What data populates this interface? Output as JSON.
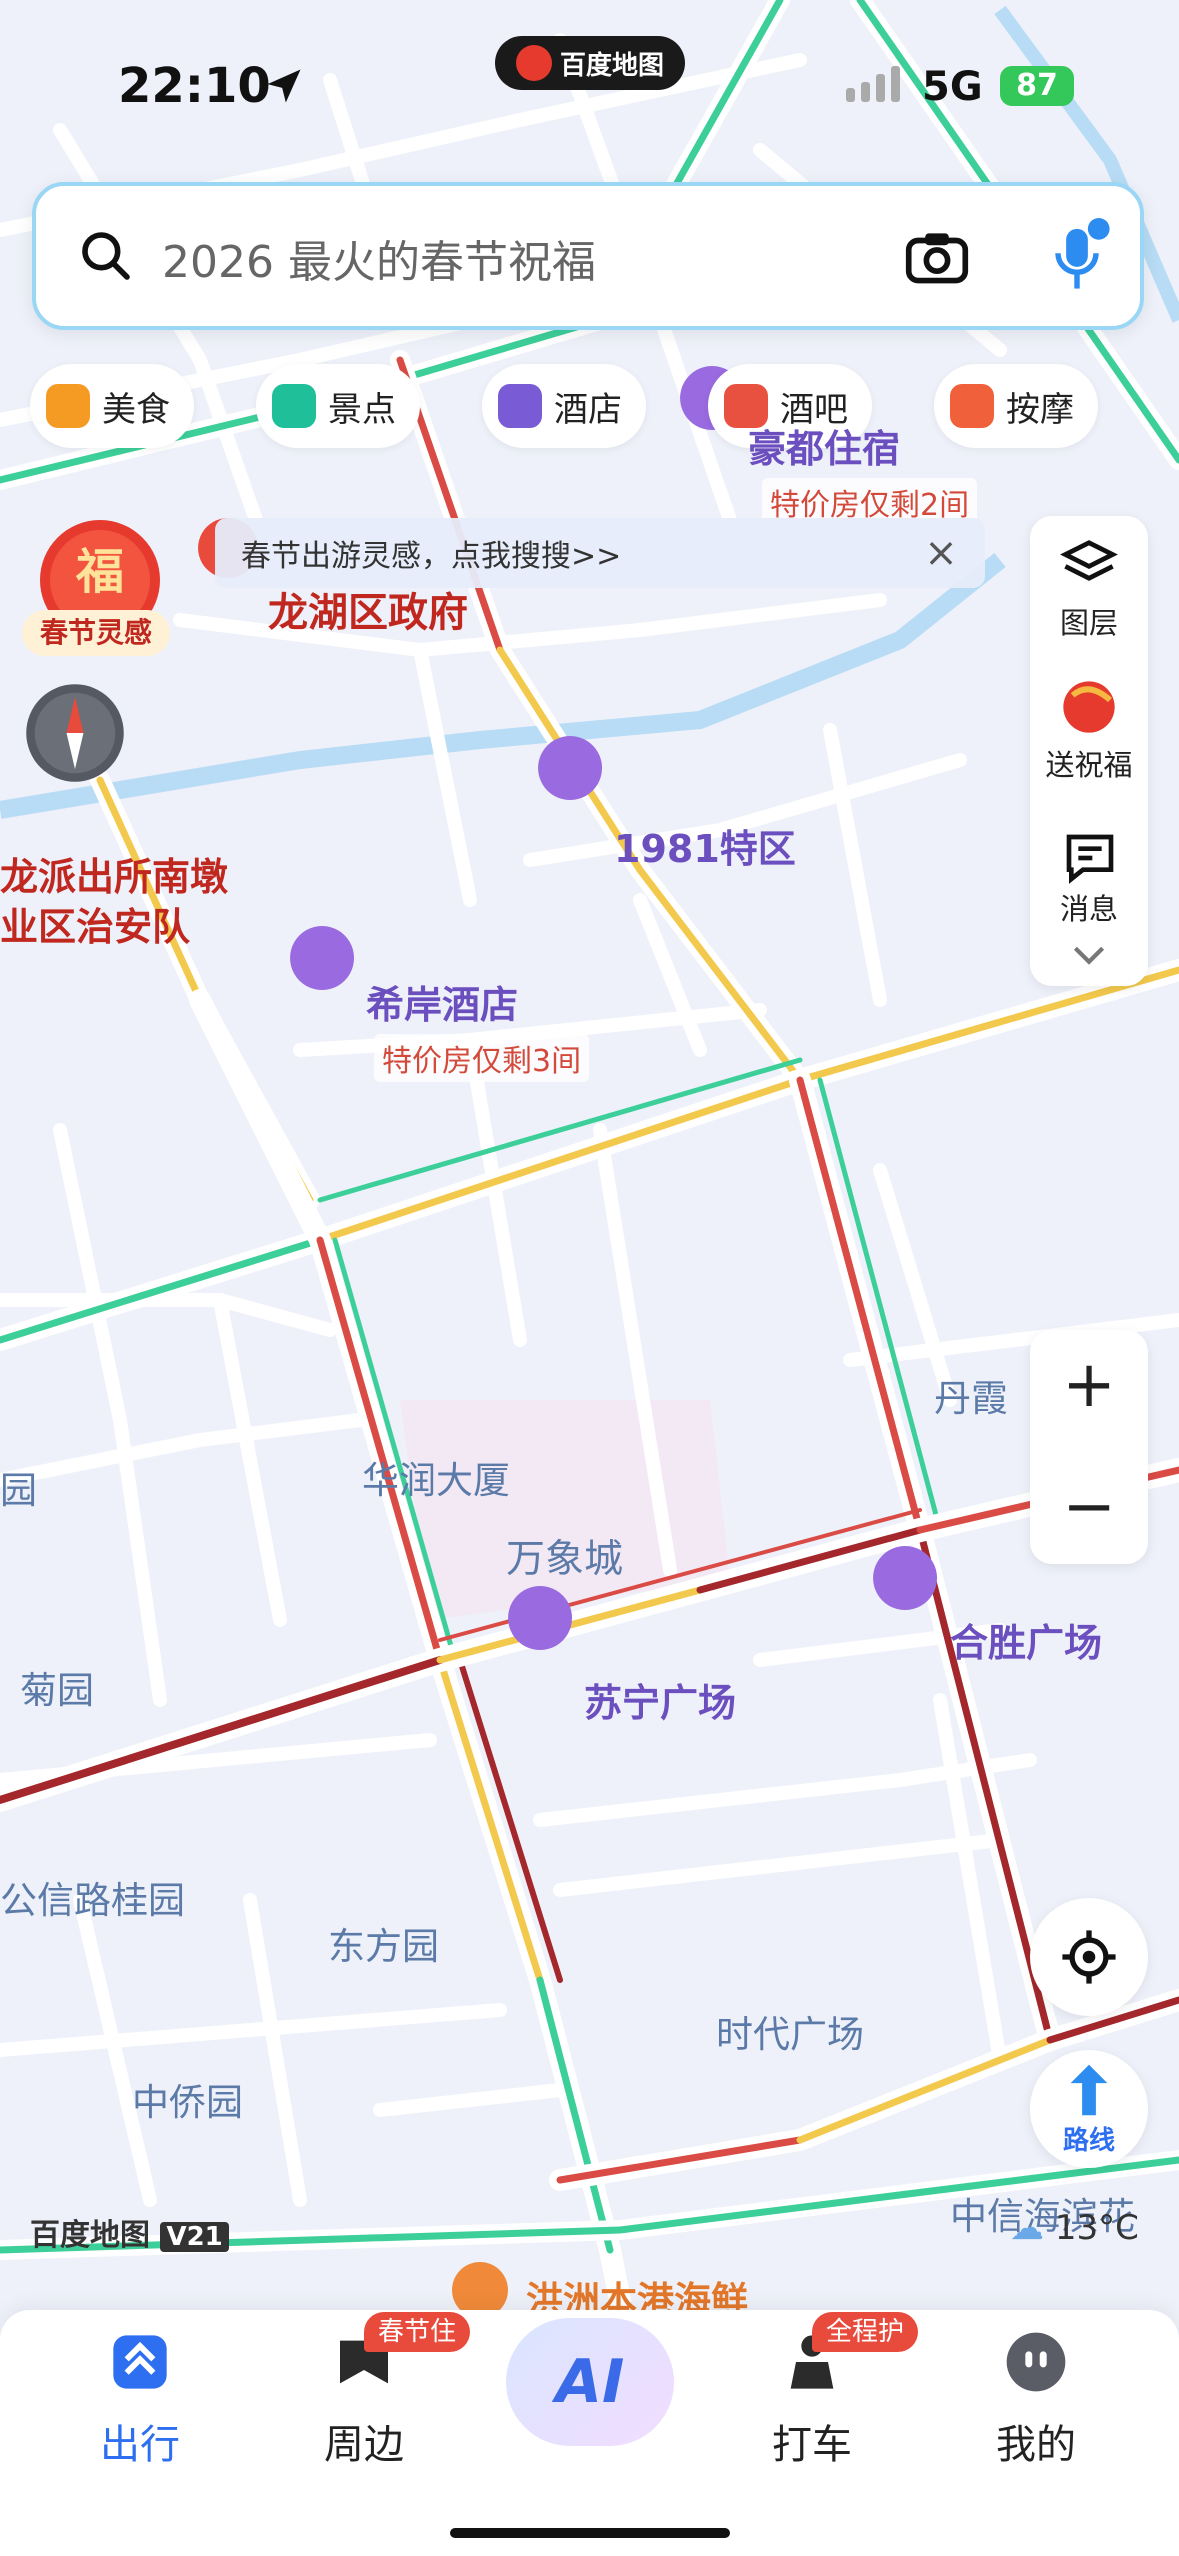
{
  "status_bar": {
    "time": "22:10",
    "app_name": "百度地图",
    "network": "5G",
    "battery": "87"
  },
  "search": {
    "placeholder": "2026 最火的春节祝福"
  },
  "categories": [
    {
      "label": "美食",
      "color": "#f59a23"
    },
    {
      "label": "景点",
      "color": "#1fbf9a"
    },
    {
      "label": "酒店",
      "color": "#7a5bd6"
    },
    {
      "label": "酒吧",
      "color": "#e8503f"
    },
    {
      "label": "按摩",
      "color": "#f0603a"
    }
  ],
  "banner": {
    "text": "春节出游灵感，点我搜搜>>"
  },
  "fu_badge": {
    "char": "福",
    "label": "春节灵感"
  },
  "right_panel": {
    "layers": "图层",
    "blessing": "送祝福",
    "messages": "消息"
  },
  "zoom": {
    "in": "+",
    "out": "−"
  },
  "route_button": {
    "label": "路线"
  },
  "map_labels": {
    "hotel_top": "豪都住宿",
    "hotel_top_deal": "特价房仅剩2间",
    "gov": "龙湖区政府",
    "police1": "龙派出所南墩",
    "police2": "业区治安队",
    "district1981": "1981特区",
    "xian_hotel": "希岸酒店",
    "xian_deal": "特价房仅剩3间",
    "danxia": "丹霞",
    "huarun": "华润大厦",
    "wanxiang": "万象城",
    "hesheng": "合胜广场",
    "yuan_left": "园",
    "juyuan": "菊园",
    "suning": "苏宁广场",
    "gongxin": "公信路桂园",
    "dongfang": "东方园",
    "shidai": "时代广场",
    "zhongqiao": "中侨园",
    "zhongxin": "中信海滨花",
    "seafood": "洪洲本港海鲜"
  },
  "map_footer": {
    "logo": "百度地图",
    "version": "V21",
    "temperature": "13°C"
  },
  "bottom_nav": [
    {
      "label": "出行",
      "badge": ""
    },
    {
      "label": "周边",
      "badge": "春节住"
    },
    {
      "label": "AI",
      "badge": ""
    },
    {
      "label": "打车",
      "badge": "全程护"
    },
    {
      "label": "我的",
      "badge": ""
    }
  ]
}
